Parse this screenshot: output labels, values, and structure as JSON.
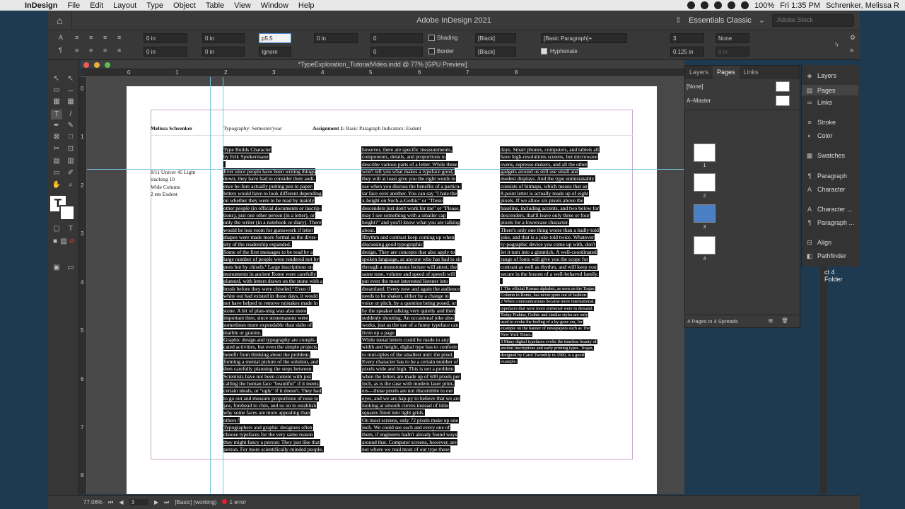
{
  "menubar": {
    "items": [
      "InDesign",
      "File",
      "Edit",
      "Layout",
      "Type",
      "Object",
      "Table",
      "View",
      "Window",
      "Help"
    ],
    "battery": "100%",
    "clock": "Fri 1:35 PM",
    "user": "Schrenker, Melissa R"
  },
  "app": {
    "title": "Adobe InDesign 2021",
    "workspace": "Essentials Classic",
    "stock_placeholder": "Adobe Stock"
  },
  "control": {
    "left_indent": "0 in",
    "right_indent": "0 in",
    "first_indent": "0 in",
    "last_indent": "0 in",
    "space_before": "p5.5",
    "space_after": "0 in",
    "dropcap_lines": "0",
    "dropcap_chars": "0",
    "ignore": "Ignore",
    "shading": "Shading",
    "border": "Border",
    "shading_swatch": "[Black]",
    "border_swatch": "[Black]",
    "para_style": "[Basic Paragraph]+",
    "columns": "3",
    "gutter": "0.125 in",
    "bullet": "None",
    "hyphenate": "Hyphenate",
    "col_small": "0 in"
  },
  "document": {
    "title": "*TypeExploration_TutorialVideo.indd @ 77% [GPU Preview]"
  },
  "rulers": {
    "h": [
      "0",
      "1",
      "2",
      "3",
      "4",
      "5",
      "6",
      "7",
      "8"
    ],
    "v": [
      "0",
      "1",
      "2",
      "3",
      "4",
      "5",
      "6",
      "7",
      "8"
    ]
  },
  "page": {
    "header": {
      "name": "Melissa Schrenker",
      "course": "Typography: Semester/year",
      "assignment_label": "Assignment 1:",
      "assignment": "Basic Paragraph Indicators: Exdent"
    },
    "specs": [
      "8/11 Univer 45 Light",
      "tracking 10",
      "Wide Column",
      "2 em Exdent"
    ],
    "col1": [
      "Type Builds Character",
      "by Erik Spiekermann",
      "",
      "Ever since people have been writing things",
      "down, they have had to consider their audi-",
      "ence be-fore actually putting pen to paper:",
      "letters would have to look different depending",
      "on whether they were to be read by mainly",
      "other people (in official documents or inscrip-",
      "tions), just one other person (in a letter), or",
      "only the writer (in a notebook or diary). There",
      "would be less room for guesswork if letter",
      "shapes were made more formal as the diver-",
      "sity of the readership expanded.",
      "Some of the first messages to be read by a",
      "large number of people were rendered not by",
      "pens but by chisels.¹ Large inscriptions on",
      "monuments in ancient Rome were carefully",
      "planned, with letters drawn on the stone with a",
      "brush before they were chiseled.² Even if",
      "white out had existed in those days, it would",
      "not have helped to remove mistakes made in",
      "stone. A bit of plan-ning was also more",
      "important then, since stonemasons were",
      "sometimes more expendable than slabs of",
      "marble or granite.",
      "Graphic design and typography are compli-",
      "cated activities, but even the simple projects",
      "benefit from thinking about the problem,",
      "forming a mental picture of the solution, and",
      "then carefully planning the steps between.",
      "Scientists have not been content with just",
      "calling the human face \"beautiful\" if it meets",
      "certain ideals, or \"ugly\" if it doesn't. They had",
      "to go out and measure proportions of nose to",
      "jaw, forehead to chin, and so on to establish",
      "why some faces are more appealing than",
      "others.³",
      "Typographers and graphic designers often",
      "choose typefaces for the very same reason",
      "they might fancy a person: They just like that",
      "person. For more scientifically-minded people,"
    ],
    "col2": [
      "however, there are specific measurements,",
      "components, details, and proportions to",
      "describe various parts of a letter. While these",
      "won't tell you what makes a typeface good,",
      "they will at least give you the right words to",
      "use when you discuss the benefits of a particu-",
      "lar face over another. You can say \"I hate the",
      "x-height on Such-a-Gothic\" or \"These",
      "descenders just don't work for me\" or \"Please,",
      "may I see something with a smaller cap",
      "height?\" and you'll know what you are talking",
      "about.",
      "Rhythm and contrast keep coming up when",
      "discussing good typographic",
      "design. They are concepts that also apply to",
      "spoken language, as anyone who has had to sit",
      "through a monotonous lecture will attest; the",
      "same tone, volume and speed of speech will",
      "put even the most interested listener into",
      "dreamland. Every now and again the audience",
      "needs to be shaken, either by a change in",
      "voice or pitch, by a question being posed, or",
      "by the speaker talking very quietly and then",
      "suddenly shouting. An occasional joke also",
      "works, just as the use of a funny typeface can",
      "liven up a page.",
      "While metal letters could be made to any",
      "width and height, digital type has to conform",
      "to mul-tiples of the smallest unit: the pixel.",
      "Every character has to be a certain number of",
      "pixels wide and high. This is not a problem",
      "when the letters are made up of 600 pixels per",
      "inch, as is the case with modern laser print-",
      "ers—those pixels are not discernible to our",
      "eyes, and we are hap-py to believe that we are",
      "looking at smooth curves instead of little",
      "squares fitted into tight grids.",
      "On most screens, only 72 pixels make up one",
      "inch. We could see each and every one of",
      "them, if engineers hadn't already found ways",
      "around that. Computer screens, however, are",
      "not where we read most of our type these"
    ],
    "col3": [
      "days. Smart phones, computers, and tablets all",
      "have high-resolutions screens, but microwave",
      "ovens, espresso makers, and all the other",
      "gadgets around us still use small and",
      "modest displays. And the type unmistakably",
      "consists of bitmaps, which means that an",
      "8-point letter is actually made up of eight",
      "pixels. If we allow six pixels above the",
      "baseline, including accents, and two below for",
      "descenders, that'll leave only three or four",
      "pixels for a lowercase character.",
      "There's only one thing worse than a badly told",
      "joke, and that is a joke told twice. Whatever",
      "ty-pographic device you come up with, don't",
      "let it turn into a gimmick. A well-coordinated",
      "range of fonts will give you the scope for",
      "contrast as well as rhythm, and will keep you",
      "secure in the bosom of a well-behaved family.",
      ""
    ],
    "footnotes": [
      "1 The official Roman alphabet, as seen on the Trajan",
      "Column in Rome, has never gone out of fashion.",
      "2 When communications became more international,",
      "typefaces that were more universal were in demand.",
      "Today Fraktur, Gothic and similar styles are only",
      "used to evoke the feeling of a by-gone era, for",
      "example on the banner of newspapers such as The",
      "New York Times.",
      "3 Many digital typefaces evoke the timeless beauty of",
      "ancient inscriptions and early printing types. Trajan,",
      "designed by Carol Twombly in 1990, is a good",
      "example."
    ]
  },
  "pages_panel": {
    "tabs": [
      "Layers",
      "Pages",
      "Links"
    ],
    "none": "[None]",
    "master": "A–Master",
    "pages": [
      "1",
      "2",
      "3",
      "4"
    ],
    "footer": "4 Pages in 4 Spreads"
  },
  "dock": [
    "Layers",
    "Pages",
    "Links",
    "Stroke",
    "Color",
    "Swatches",
    "Paragraph",
    "Character",
    "Character ...",
    "Paragraph ...",
    "Align",
    "Pathfinder"
  ],
  "status": {
    "zoom": "77.06%",
    "page": "3",
    "style": "[Basic] (working)",
    "errors": "1 error"
  },
  "desktop": {
    "label1": "ct 4",
    "label2": "Folder"
  }
}
